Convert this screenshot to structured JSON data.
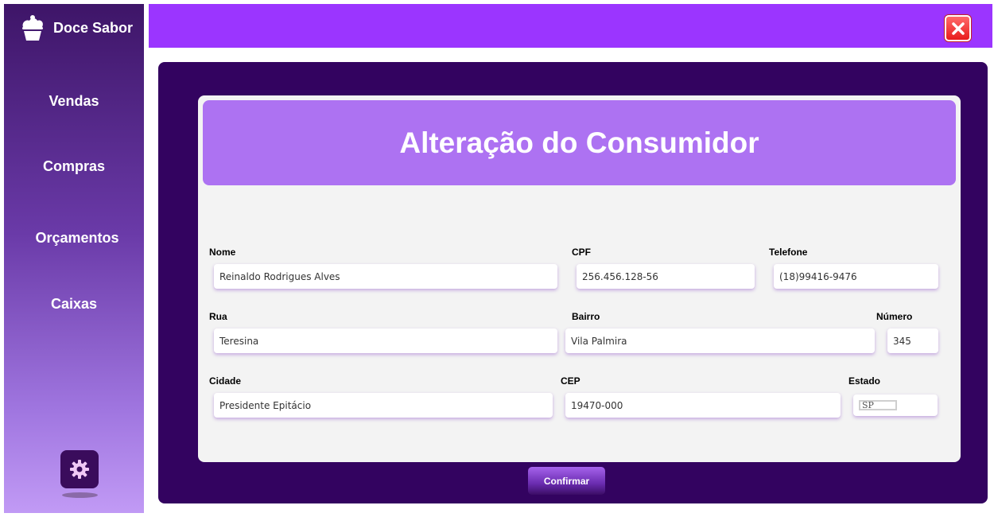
{
  "app": {
    "brand": "Doce Sabor"
  },
  "sidebar": {
    "items": [
      {
        "label": "Vendas"
      },
      {
        "label": "Compras"
      },
      {
        "label": "Orçamentos"
      },
      {
        "label": "Caixas"
      }
    ]
  },
  "form": {
    "title": "Alteração do Consumidor",
    "fields": {
      "nome": {
        "label": "Nome",
        "value": "Reinaldo Rodrigues Alves"
      },
      "cpf": {
        "label": "CPF",
        "value": "256.456.128-56"
      },
      "telefone": {
        "label": "Telefone",
        "value": "(18)99416-9476"
      },
      "rua": {
        "label": "Rua",
        "value": "Teresina"
      },
      "bairro": {
        "label": "Bairro",
        "value": "Vila Palmira"
      },
      "numero": {
        "label": "Número",
        "value": "345"
      },
      "cidade": {
        "label": "Cidade",
        "value": "Presidente Epitácio"
      },
      "cep": {
        "label": "CEP",
        "value": "19470-000"
      },
      "estado": {
        "label": "Estado",
        "value": "SP"
      }
    },
    "confirm_label": "Confirmar"
  },
  "colors": {
    "topbar": "#9b35ff",
    "main_panel": "#330360",
    "card_header": "#ad72f2",
    "close_button": "#e81c1c"
  },
  "icons": [
    "cupcake-icon",
    "close-icon",
    "gear-icon"
  ]
}
